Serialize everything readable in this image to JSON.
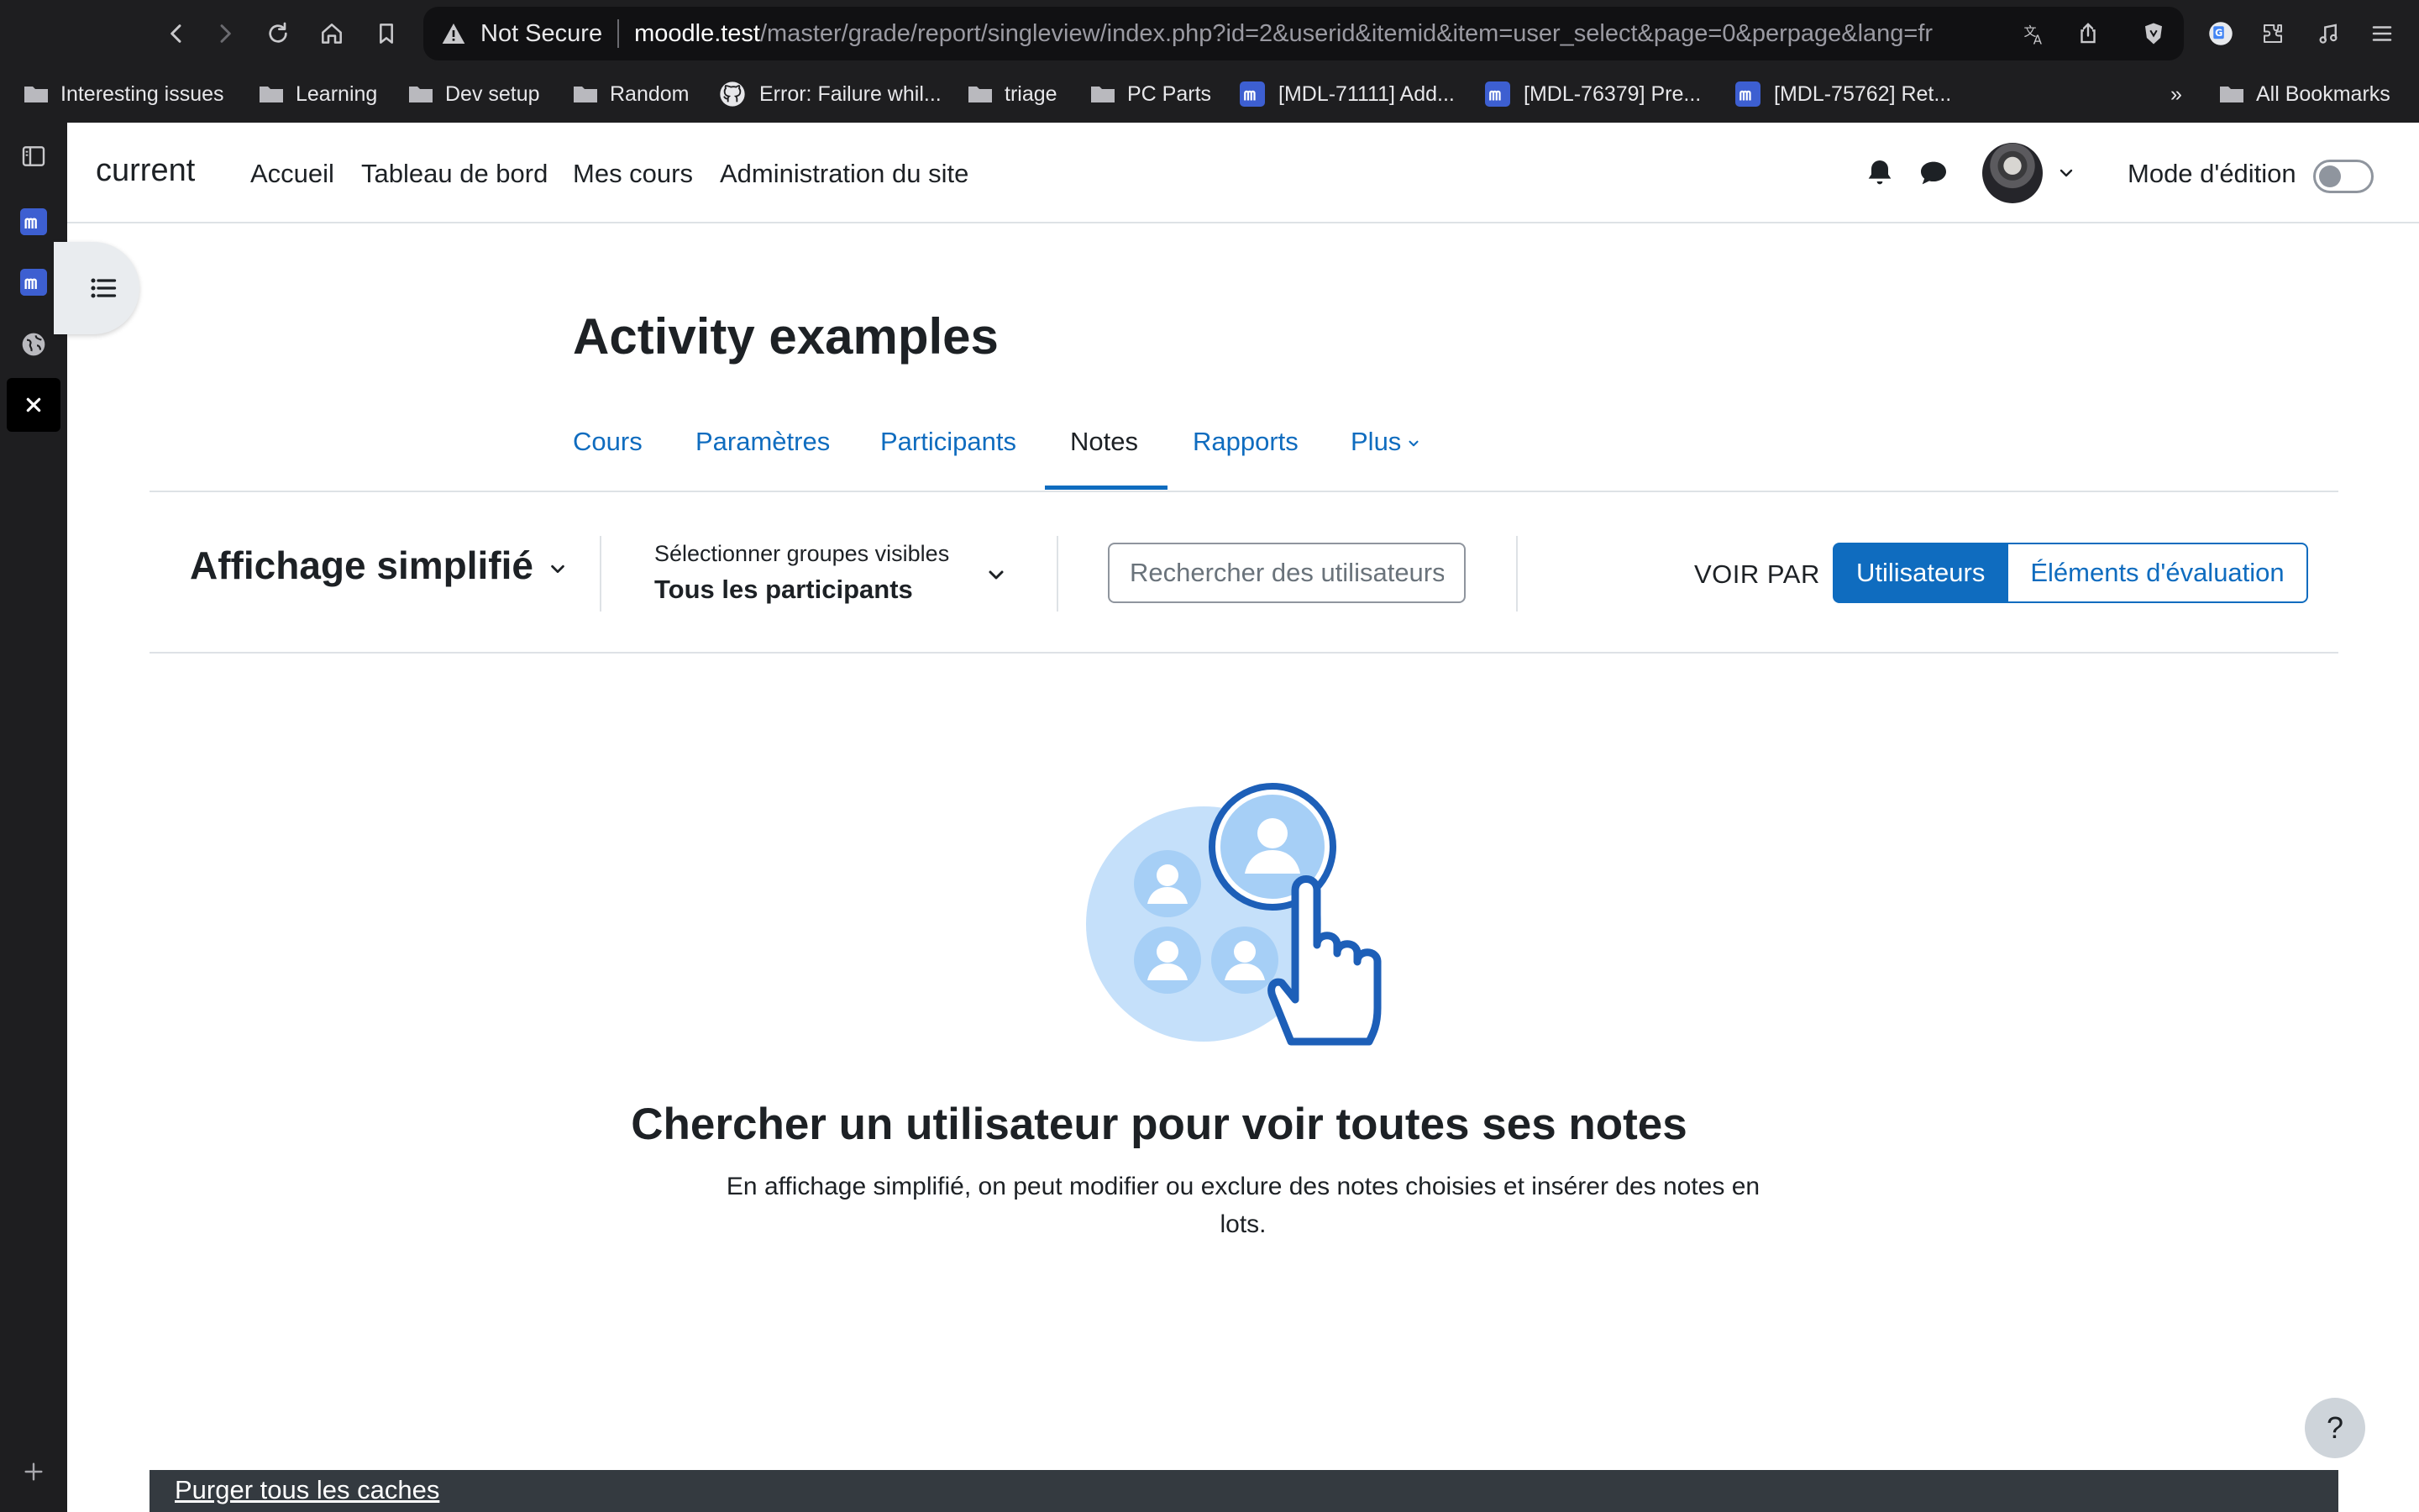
{
  "browser": {
    "url_security": "Not Secure",
    "url_host": "moodle.test",
    "url_path": "/master/grade/report/singleview/index.php?id=2&userid&itemid&item=user_select&page=0&perpage&lang=fr",
    "overflow_chevron": "»",
    "bookmarks": [
      {
        "label": "Interesting issues",
        "icon": "folder-icon"
      },
      {
        "label": "Learning",
        "icon": "folder-icon"
      },
      {
        "label": "Dev setup",
        "icon": "folder-icon"
      },
      {
        "label": "Random",
        "icon": "folder-icon"
      },
      {
        "label": "Error: Failure whil...",
        "icon": "github-icon"
      },
      {
        "label": "triage",
        "icon": "folder-icon"
      },
      {
        "label": "PC Parts",
        "icon": "folder-icon"
      },
      {
        "label": "[MDL-71111] Add...",
        "icon": "moodle-tracker-icon"
      },
      {
        "label": "[MDL-76379] Pre...",
        "icon": "moodle-tracker-icon"
      },
      {
        "label": "[MDL-75762] Ret...",
        "icon": "moodle-tracker-icon"
      }
    ],
    "all_bookmarks": "All Bookmarks"
  },
  "moodle_nav": {
    "site_name": "current",
    "links": [
      "Accueil",
      "Tableau de bord",
      "Mes cours",
      "Administration du site"
    ],
    "edit_mode_label": "Mode d'édition",
    "edit_mode_on": false
  },
  "page": {
    "title": "Activity examples",
    "tabs": [
      {
        "label": "Cours",
        "active": false
      },
      {
        "label": "Paramètres",
        "active": false
      },
      {
        "label": "Participants",
        "active": false
      },
      {
        "label": "Notes",
        "active": true
      },
      {
        "label": "Rapports",
        "active": false
      },
      {
        "label": "Plus",
        "active": false
      }
    ]
  },
  "toolbar": {
    "report_selector": "Affichage simplifié",
    "group_label": "Sélectionner groupes visibles",
    "group_value": "Tous les participants",
    "search_placeholder": "Rechercher des utilisateurs",
    "viewby_label": "VOIR PAR",
    "viewby_options": [
      "Utilisateurs",
      "Éléments d'évaluation"
    ],
    "viewby_active": "Utilisateurs"
  },
  "empty_state": {
    "heading": "Chercher un utilisateur pour voir toutes ses notes",
    "description": "En affichage simplifié, on peut modifier ou exclure des notes choisies et insérer des notes en lots."
  },
  "footer": {
    "purge_link": "Purger tous les caches",
    "help": "?"
  },
  "colors": {
    "primary": "#0f6cbf",
    "chrome": "#1e1e20",
    "footer": "#343a40",
    "illustration_light": "#c5e0fa",
    "illustration_mid": "#a6cff6",
    "illustration_dark": "#1d5fb8"
  }
}
